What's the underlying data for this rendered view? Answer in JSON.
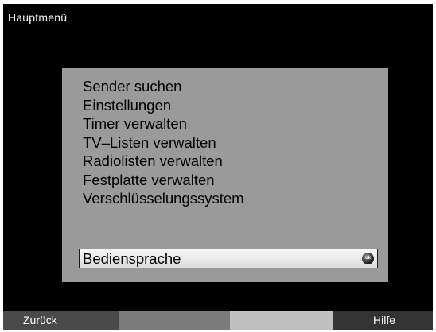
{
  "header": {
    "title": "Hauptmenü"
  },
  "menu": {
    "items": [
      "Sender suchen",
      "Einstellungen",
      "Timer verwalten",
      "TV–Listen verwalten",
      "Radiolisten verwalten",
      "Festplatte verwalten",
      "Verschlüsselungssystem"
    ],
    "selected_label": "Bediensprache",
    "selected_icon": "ok-button-icon",
    "ok_icon_text": "ok"
  },
  "footer": {
    "back_label": "Zurück",
    "help_label": "Hilfe"
  },
  "colors": {
    "background": "#000000",
    "panel": "#9a9a9a",
    "selection": "#e8e8e8"
  }
}
